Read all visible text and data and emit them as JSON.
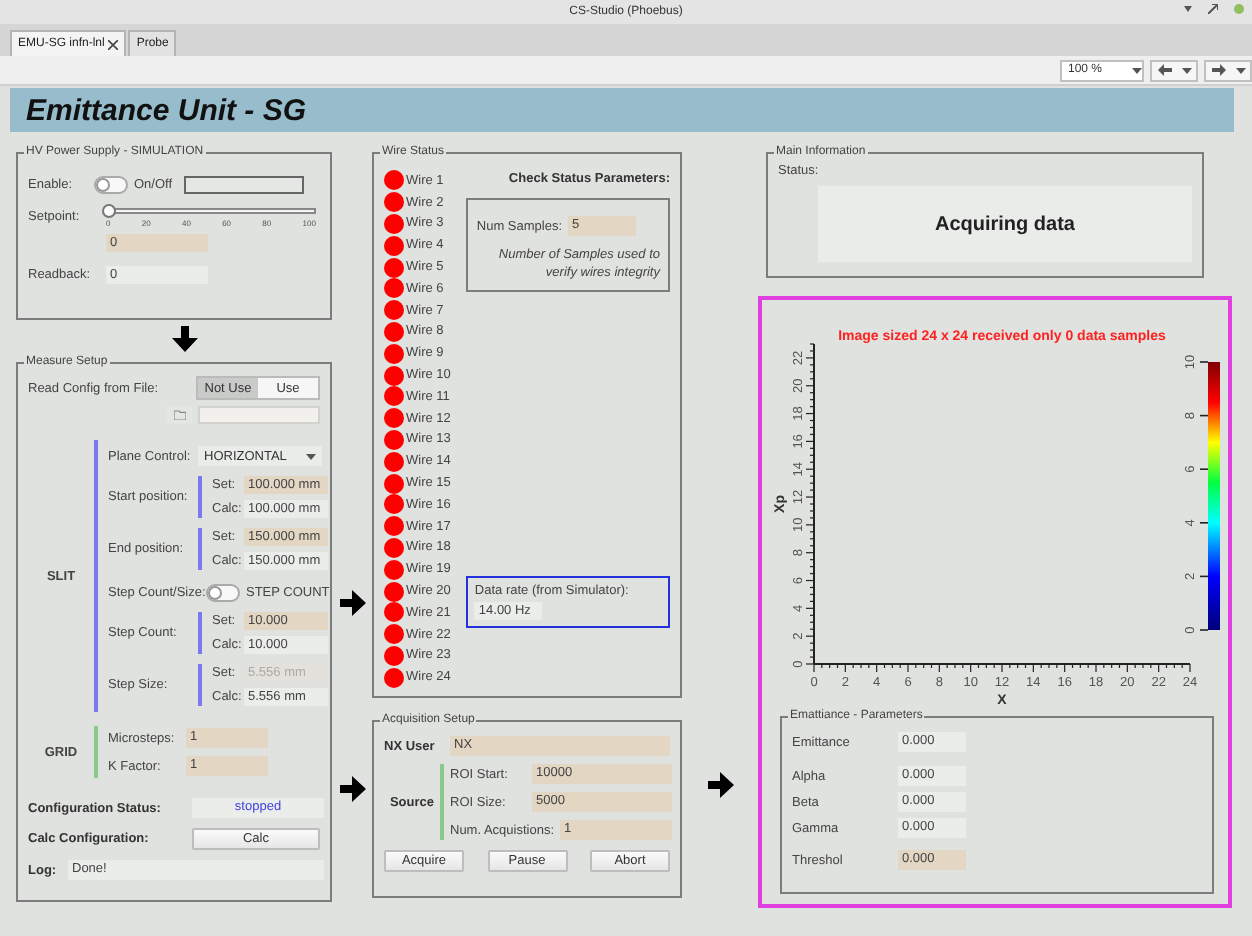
{
  "window": {
    "title": "CS-Studio (Phoebus)"
  },
  "tabs": [
    {
      "label": "EMU-SG infn-lnl",
      "selected": true
    },
    {
      "label": "Probe",
      "selected": false
    }
  ],
  "toolbar": {
    "zoom": "100 %"
  },
  "header": {
    "title": "Emittance Unit - SG"
  },
  "hv_power_supply": {
    "title": "HV Power Supply - SIMULATION",
    "enable_label": "Enable:",
    "toggle": {
      "label": "On/Off",
      "on": false
    },
    "setpoint_label": "Setpoint:",
    "slider": {
      "level": 0,
      "ticks": [
        "0",
        "20",
        "40",
        "60",
        "80",
        "100"
      ]
    },
    "setpoint": "0",
    "readback_label": "Readback:",
    "readback": "0"
  },
  "measure_setup": {
    "title": "Measure Setup",
    "read_config": {
      "label": "Read Config from File:",
      "options": [
        {
          "label": "Not Use",
          "selected": true
        },
        {
          "label": "Use",
          "selected": false
        }
      ]
    },
    "slit": {
      "label": "SLIT",
      "rows": [
        {
          "kind": "dropdown",
          "label": "Plane Control:",
          "value": "HORIZONTAL"
        },
        {
          "kind": "setcalc",
          "label": "Start position:",
          "set_label": "Set:",
          "set": "100.000 mm",
          "set_disabled": false,
          "calc_label": "Calc:",
          "calc": "100.000 mm"
        },
        {
          "kind": "setcalc",
          "label": "End position:",
          "set_label": "Set:",
          "set": "150.000 mm",
          "set_disabled": false,
          "calc_label": "Calc:",
          "calc": "150.000 mm"
        },
        {
          "kind": "toggle",
          "label": "Step Count/Size:",
          "toggle_label": "STEP COUNT",
          "on": false
        },
        {
          "kind": "setcalc",
          "label": "Step Count:",
          "set_label": "Set:",
          "set": "10.000",
          "set_disabled": false,
          "calc_label": "Calc:",
          "calc": "10.000"
        },
        {
          "kind": "setcalc",
          "label": "Step Size:",
          "set_label": "Set:",
          "set": "5.556 mm",
          "set_disabled": true,
          "calc_label": "Calc:",
          "calc": "5.556 mm"
        }
      ]
    },
    "grid": {
      "label": "GRID",
      "rows": [
        {
          "label": "Microsteps:",
          "value": "1"
        },
        {
          "label": "K Factor:",
          "value": "1"
        }
      ]
    },
    "config_status": {
      "label": "Configuration Status:",
      "value": "stopped"
    },
    "calc_config": {
      "label": "Calc Configuration:",
      "button": "Calc"
    },
    "log": {
      "label": "Log:",
      "value": "Done!"
    }
  },
  "wire_status": {
    "title": "Wire Status",
    "wires": [
      {
        "label": "Wire 1",
        "color": "#ff0000"
      },
      {
        "label": "Wire 2",
        "color": "#ff0000"
      },
      {
        "label": "Wire 3",
        "color": "#ff0000"
      },
      {
        "label": "Wire 4",
        "color": "#ff0000"
      },
      {
        "label": "Wire 5",
        "color": "#ff0000"
      },
      {
        "label": "Wire 6",
        "color": "#ff0000"
      },
      {
        "label": "Wire 7",
        "color": "#ff0000"
      },
      {
        "label": "Wire 8",
        "color": "#ff0000"
      },
      {
        "label": "Wire 9",
        "color": "#ff0000"
      },
      {
        "label": "Wire 10",
        "color": "#ff0000"
      },
      {
        "label": "Wire 11",
        "color": "#ff0000"
      },
      {
        "label": "Wire 12",
        "color": "#ff0000"
      },
      {
        "label": "Wire 13",
        "color": "#ff0000"
      },
      {
        "label": "Wire 14",
        "color": "#ff0000"
      },
      {
        "label": "Wire 15",
        "color": "#ff0000"
      },
      {
        "label": "Wire 16",
        "color": "#ff0000"
      },
      {
        "label": "Wire 17",
        "color": "#ff0000"
      },
      {
        "label": "Wire 18",
        "color": "#ff0000"
      },
      {
        "label": "Wire 19",
        "color": "#ff0000"
      },
      {
        "label": "Wire 20",
        "color": "#ff0000"
      },
      {
        "label": "Wire 21",
        "color": "#ff0000"
      },
      {
        "label": "Wire 22",
        "color": "#ff0000"
      },
      {
        "label": "Wire 23",
        "color": "#ff0000"
      },
      {
        "label": "Wire 24",
        "color": "#ff0000"
      }
    ],
    "check_title": "Check Status Parameters:",
    "num_samples_label": "Num Samples:",
    "num_samples": "5",
    "note": "Number of Samples used to verify wires integrity",
    "data_rate_label": "Data rate (from Simulator):",
    "data_rate": "14.00 Hz"
  },
  "acquisition_setup": {
    "title": "Acquisition Setup",
    "nx_user_label": "NX User",
    "nx_user": "NX",
    "source_label": "Source",
    "source_rows": [
      {
        "label": "ROI Start:",
        "value": "10000"
      },
      {
        "label": "ROI Size:",
        "value": "5000"
      },
      {
        "label": "Num. Acquistions:",
        "value": "1"
      }
    ],
    "buttons": [
      "Acquire",
      "Pause",
      "Abort"
    ]
  },
  "main_information": {
    "title": "Main Information",
    "status_label": "Status:",
    "status": "Acquiring data"
  },
  "image_plot": {
    "chart_data": {
      "type": "scatter",
      "title": "Image sized 24 x 24 received only 0 data samples",
      "xlabel": "X",
      "ylabel": "Xp",
      "xlim": [
        0,
        24
      ],
      "ylim": [
        0,
        23
      ],
      "xticks": [
        0,
        2,
        4,
        6,
        8,
        10,
        12,
        14,
        16,
        18,
        20,
        22,
        24
      ],
      "yticks": [
        0,
        2,
        4,
        6,
        8,
        10,
        12,
        14,
        16,
        18,
        20,
        22
      ]
    },
    "colorbar_ticks": [
      "0",
      "2",
      "4",
      "6",
      "8",
      "10"
    ]
  },
  "emittance_parameters": {
    "title": "Emattiance - Parameters",
    "rows": [
      {
        "label": "Emittance",
        "value": "0.000",
        "editable": false
      },
      {
        "label": "Alpha",
        "value": "0.000",
        "editable": false
      },
      {
        "label": "Beta",
        "value": "0.000",
        "editable": false
      },
      {
        "label": "Gamma",
        "value": "0.000",
        "editable": false
      },
      {
        "label": "Threshol",
        "value": "0.000",
        "editable": true
      }
    ]
  }
}
